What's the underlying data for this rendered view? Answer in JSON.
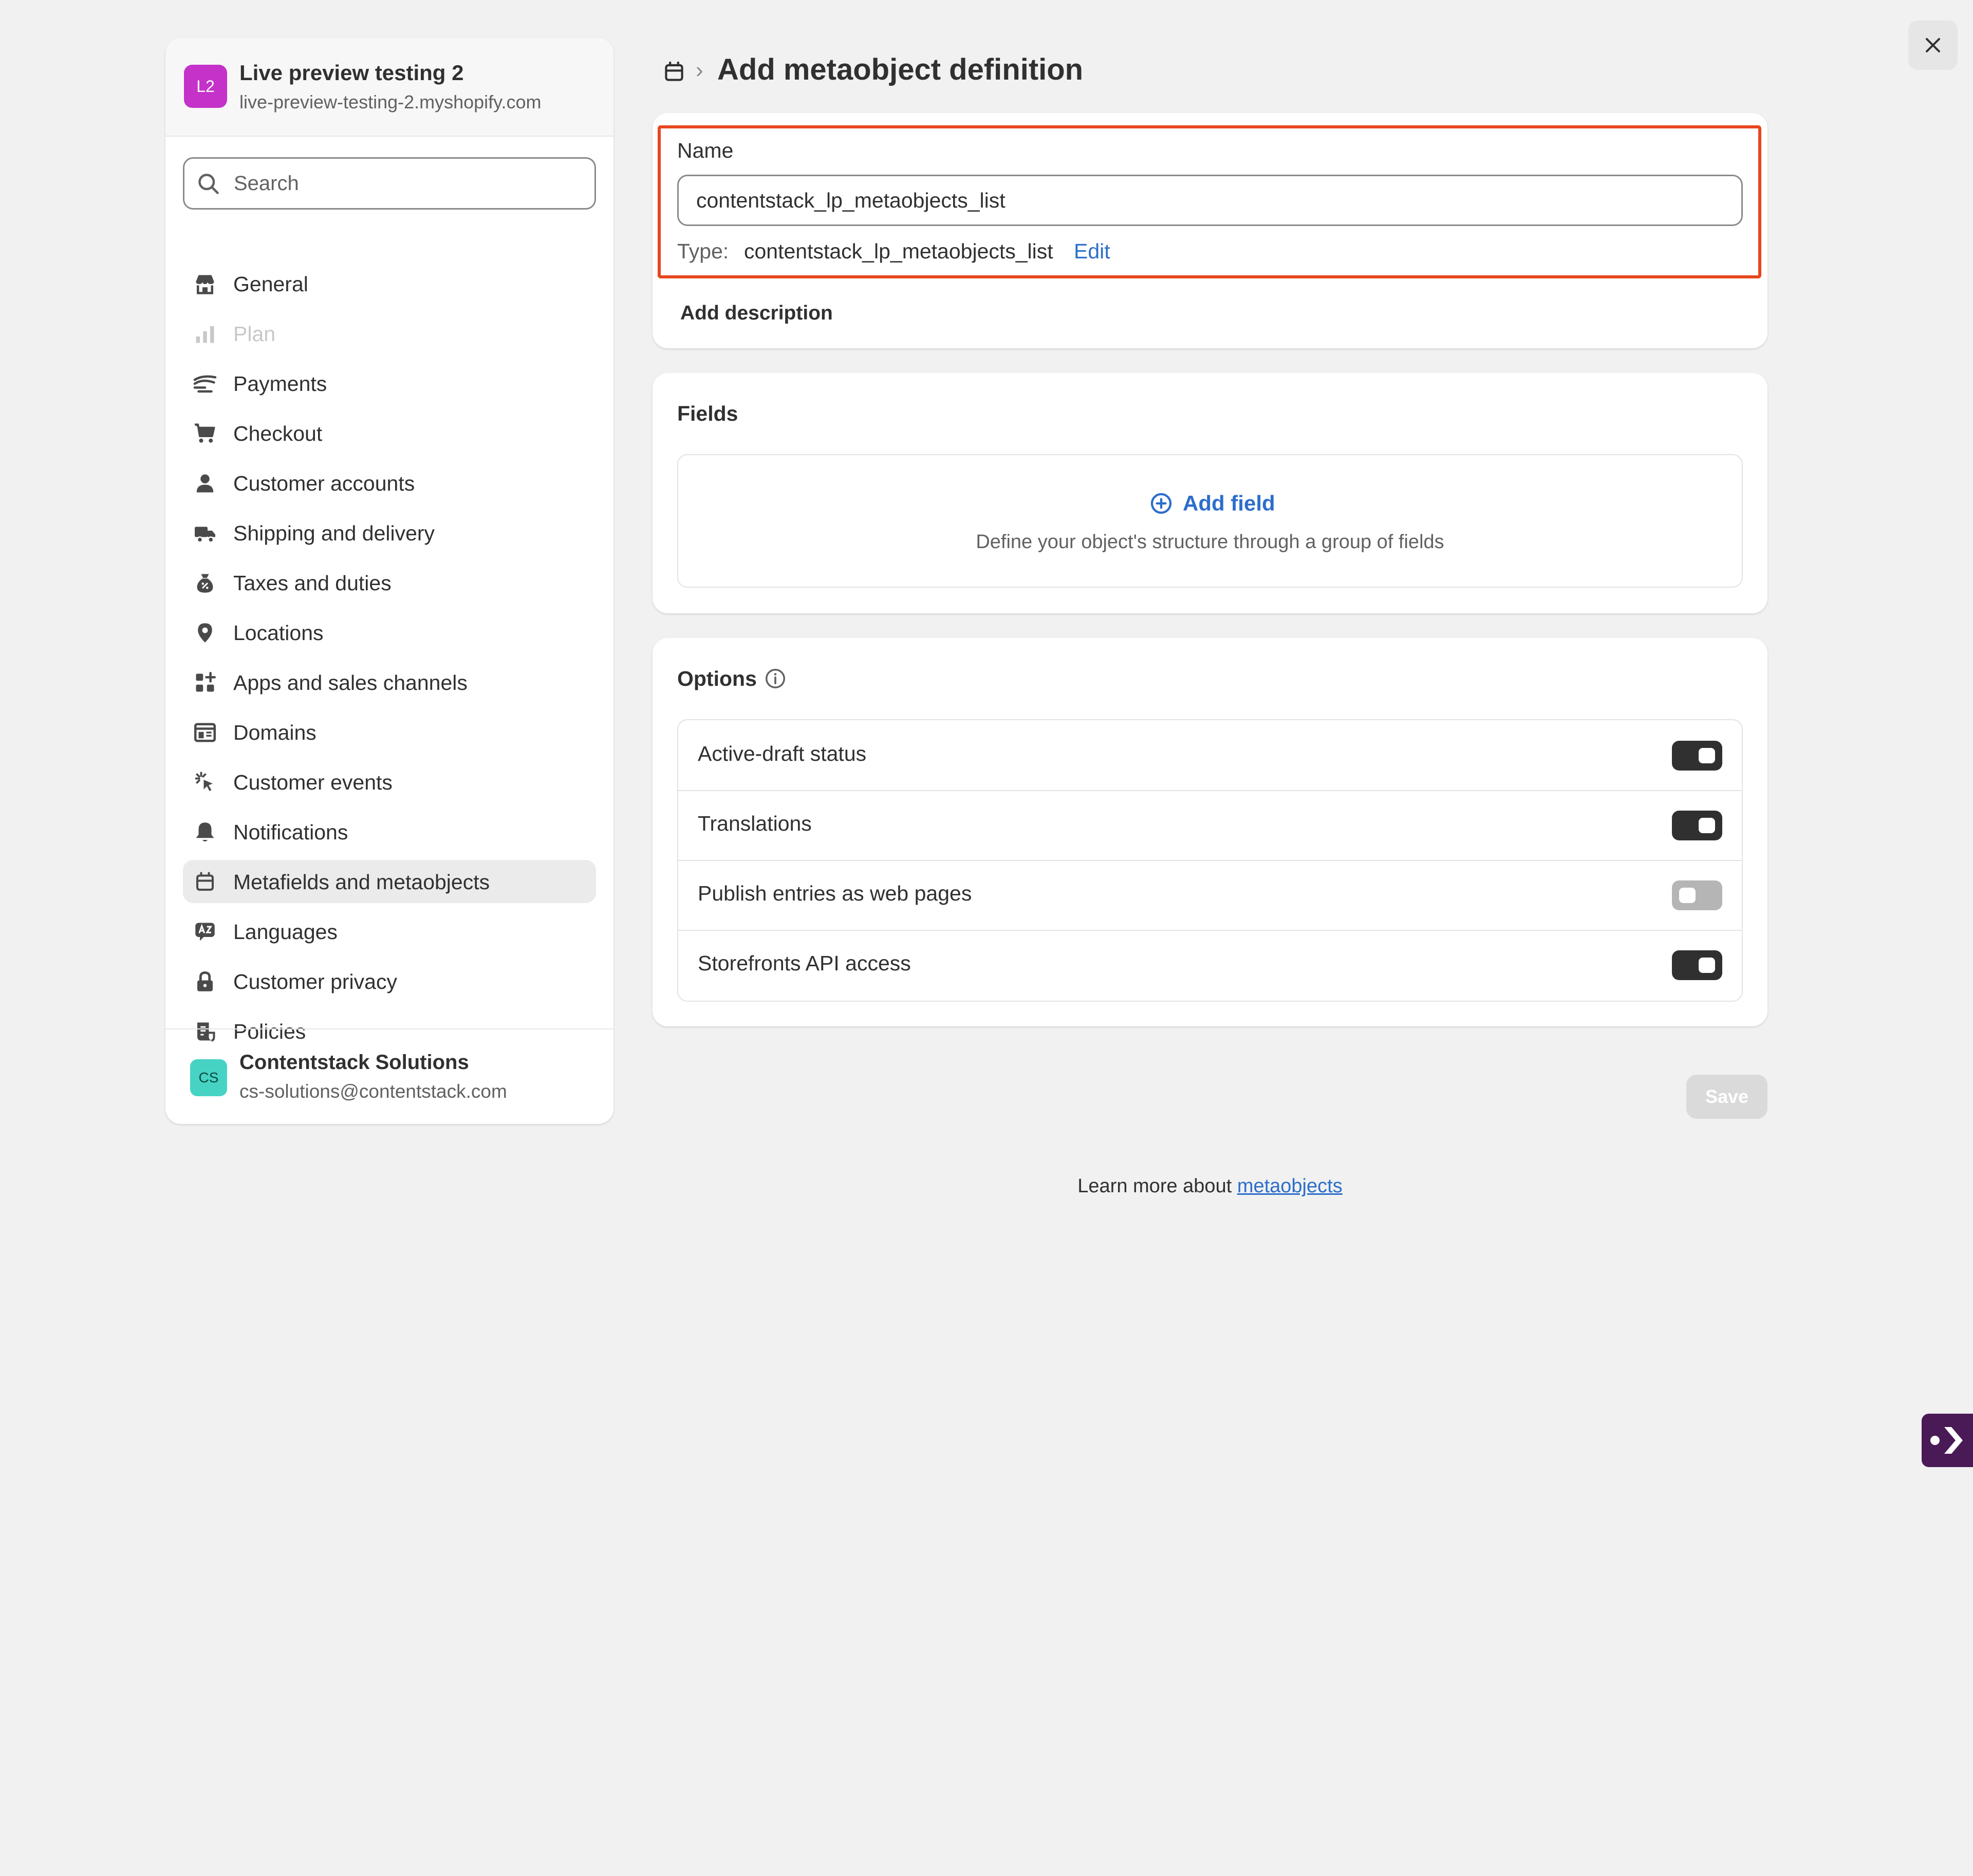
{
  "sidebar": {
    "store": {
      "avatar_initials": "L2",
      "avatar_color": "#c432c9",
      "name": "Live preview testing 2",
      "url": "live-preview-testing-2.myshopify.com"
    },
    "search": {
      "placeholder": "Search"
    },
    "items": [
      {
        "label": "General",
        "icon": "store-icon",
        "state": "normal"
      },
      {
        "label": "Plan",
        "icon": "chart-icon",
        "state": "disabled"
      },
      {
        "label": "Payments",
        "icon": "payments-icon",
        "state": "normal"
      },
      {
        "label": "Checkout",
        "icon": "cart-icon",
        "state": "normal"
      },
      {
        "label": "Customer accounts",
        "icon": "person-icon",
        "state": "normal"
      },
      {
        "label": "Shipping and delivery",
        "icon": "truck-icon",
        "state": "normal"
      },
      {
        "label": "Taxes and duties",
        "icon": "tax-bag-icon",
        "state": "normal"
      },
      {
        "label": "Locations",
        "icon": "location-pin-icon",
        "state": "normal"
      },
      {
        "label": "Apps and sales channels",
        "icon": "apps-icon",
        "state": "normal"
      },
      {
        "label": "Domains",
        "icon": "domain-icon",
        "state": "normal"
      },
      {
        "label": "Customer events",
        "icon": "cursor-click-icon",
        "state": "normal"
      },
      {
        "label": "Notifications",
        "icon": "bell-icon",
        "state": "normal"
      },
      {
        "label": "Metafields and metaobjects",
        "icon": "metaobject-icon",
        "state": "active"
      },
      {
        "label": "Languages",
        "icon": "language-icon",
        "state": "normal"
      },
      {
        "label": "Customer privacy",
        "icon": "lock-icon",
        "state": "normal"
      },
      {
        "label": "Policies",
        "icon": "policy-icon",
        "state": "normal"
      }
    ],
    "account": {
      "avatar_initials": "CS",
      "avatar_color": "#46d3c4",
      "name": "Contentstack Solutions",
      "email": "cs-solutions@contentstack.com"
    }
  },
  "header": {
    "breadcrumb_icon": "metaobject-icon",
    "breadcrumb_separator": "›",
    "title": "Add metaobject definition"
  },
  "name_card": {
    "name_label": "Name",
    "name_value": "contentstack_lp_metaobjects_list",
    "type_label": "Type:",
    "type_value": "contentstack_lp_metaobjects_list",
    "edit_label": "Edit",
    "add_description_label": "Add description",
    "highlight_color": "#e8461e"
  },
  "fields_card": {
    "title": "Fields",
    "add_field_label": "Add field",
    "help_text": "Define your object's structure through a group of fields"
  },
  "options_card": {
    "title": "Options",
    "items": [
      {
        "label": "Active-draft status",
        "enabled": true
      },
      {
        "label": "Translations",
        "enabled": true
      },
      {
        "label": "Publish entries as web pages",
        "enabled": false
      },
      {
        "label": "Storefronts API access",
        "enabled": true
      }
    ]
  },
  "footer": {
    "save_label": "Save",
    "learn_more_text": "Learn more about ",
    "learn_more_link": "metaobjects"
  },
  "colors": {
    "accent_link": "#2c6ecb",
    "background": "#f1f1f1",
    "toggle_on": "#303030",
    "toggle_off": "#b5b5b5"
  }
}
